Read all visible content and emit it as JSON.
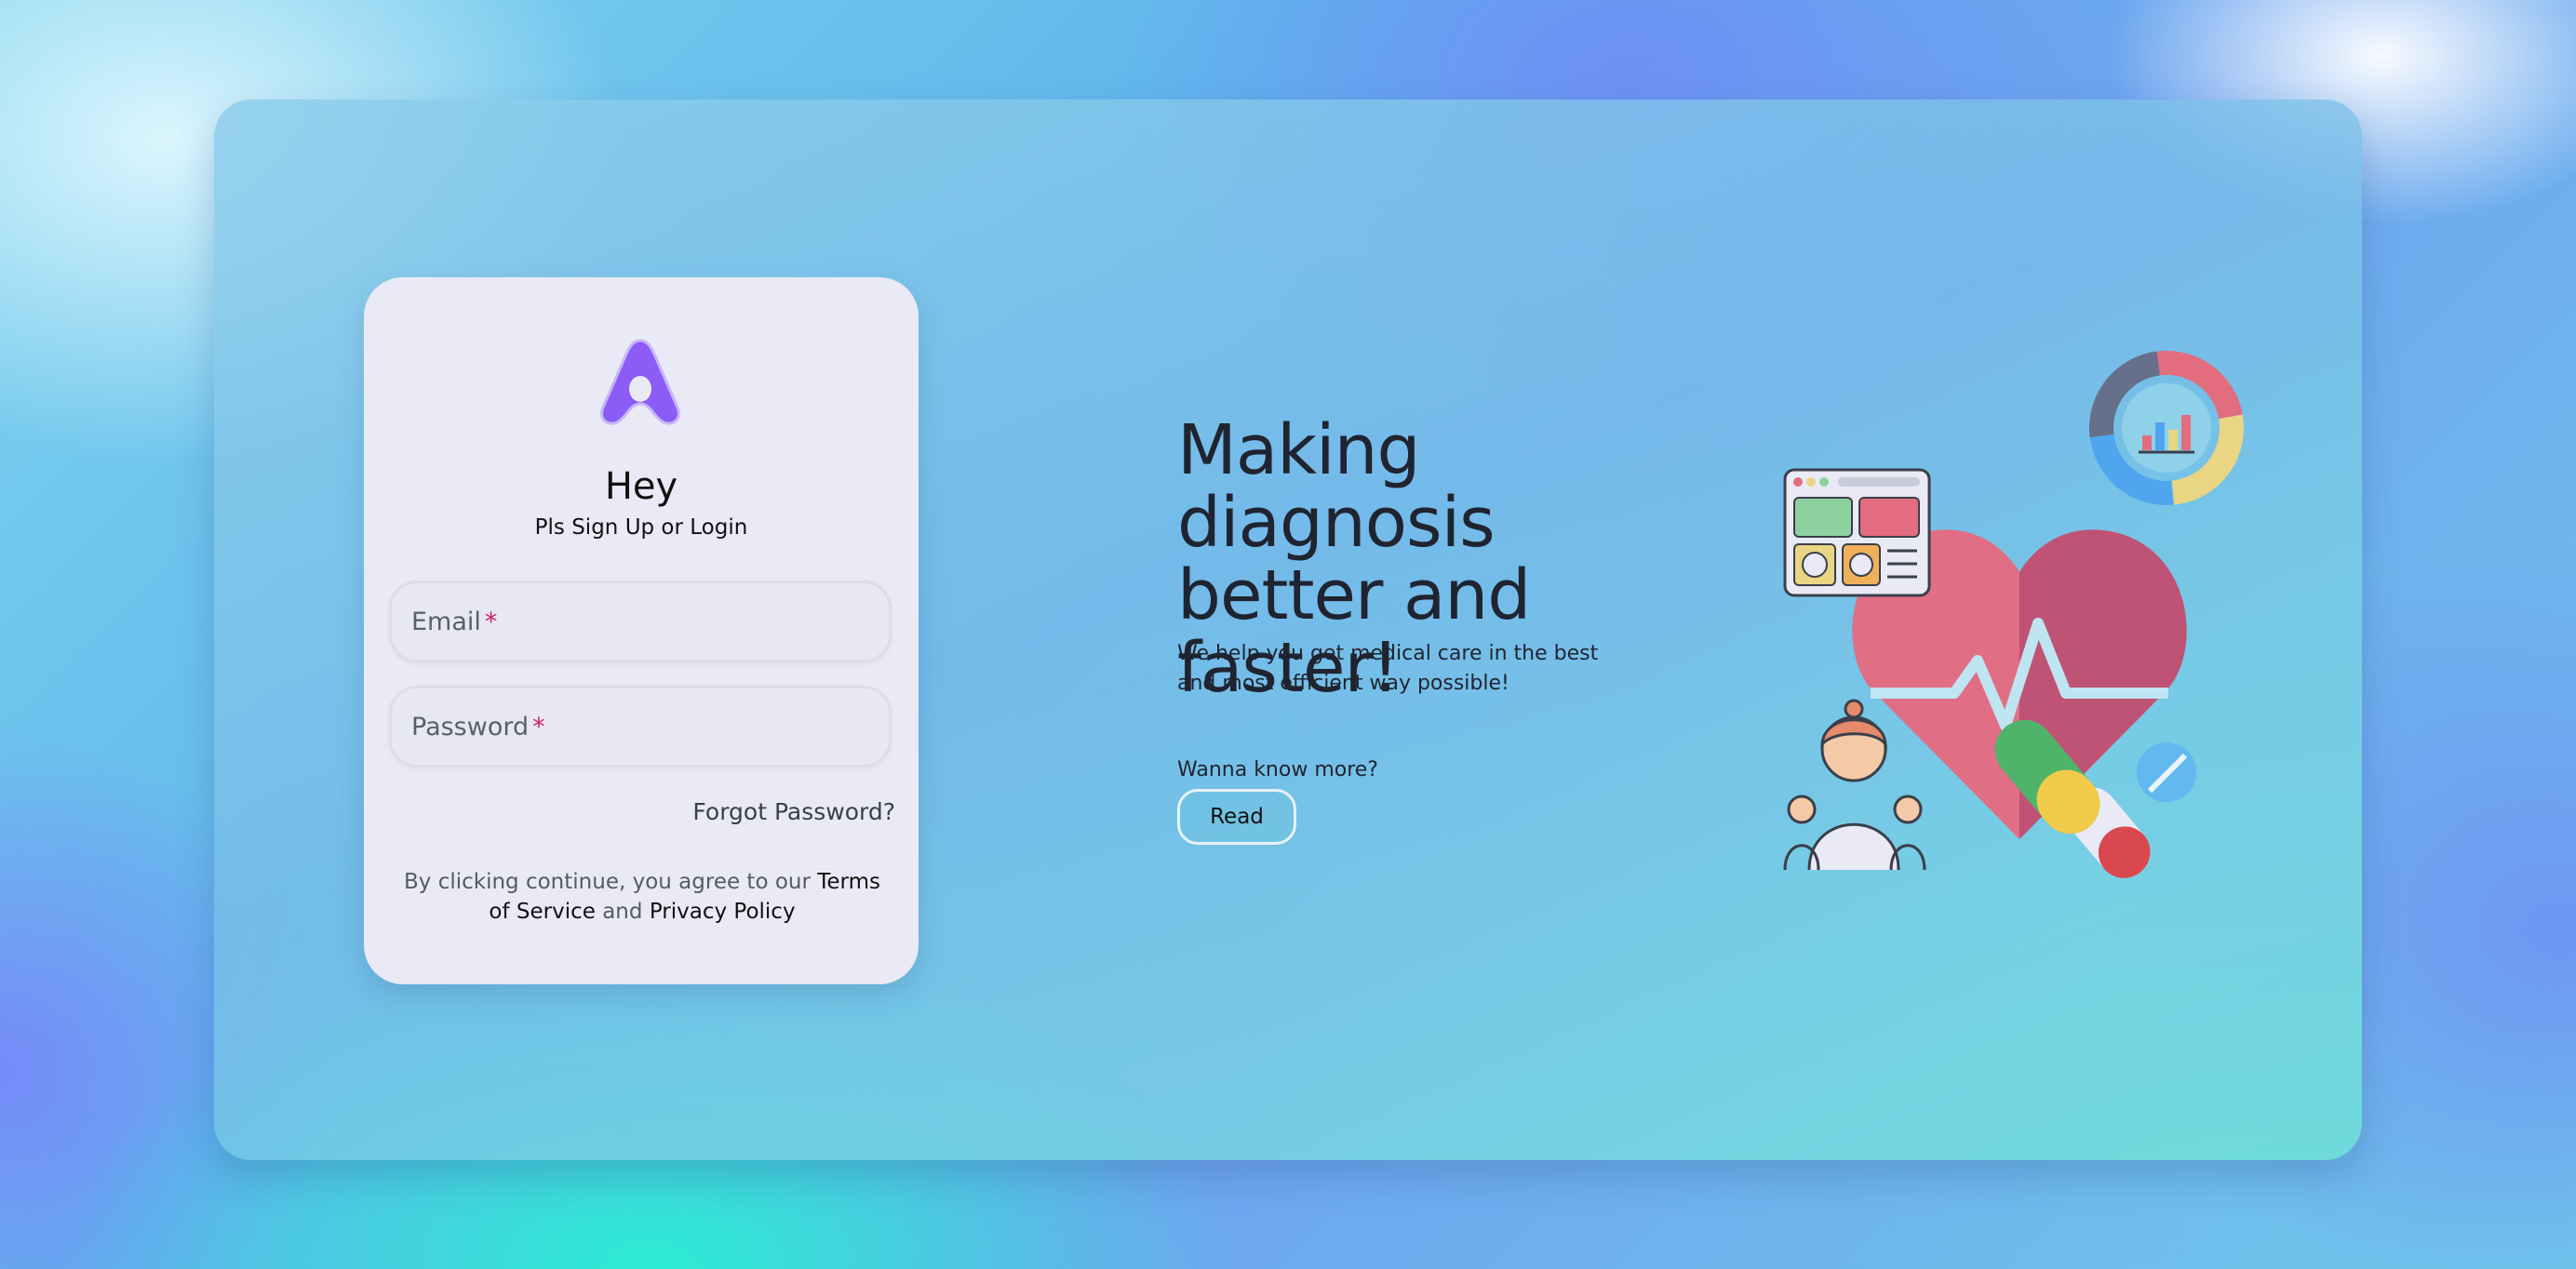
{
  "login": {
    "greeting": "Hey",
    "subtitle": "Pls Sign Up or Login",
    "email_label": "Email",
    "password_label": "Password",
    "required_mark": "*",
    "forgot_password": "Forgot Password?",
    "terms_prefix": "By clicking continue, you agree to our ",
    "terms_link": "Terms of Service",
    "terms_and": " and ",
    "privacy_link": "Privacy Policy"
  },
  "hero": {
    "headline": "Making diagnosis better and faster!",
    "description": "We help you get medical care in the best and most efficient way possible!",
    "more_prompt": "Wanna know more?",
    "read_button": "Read"
  },
  "icons": {
    "logo": "brand-logo-icon",
    "illustration": [
      "donut-chart-icon",
      "dashboard-icon",
      "heart-pulse-icon",
      "doctor-icon",
      "pills-icon"
    ]
  },
  "colors": {
    "card_bg": "#e9eaf5",
    "logo_purple": "#8b5cf6",
    "required": "#d0245e",
    "heart": "#df6e84"
  }
}
